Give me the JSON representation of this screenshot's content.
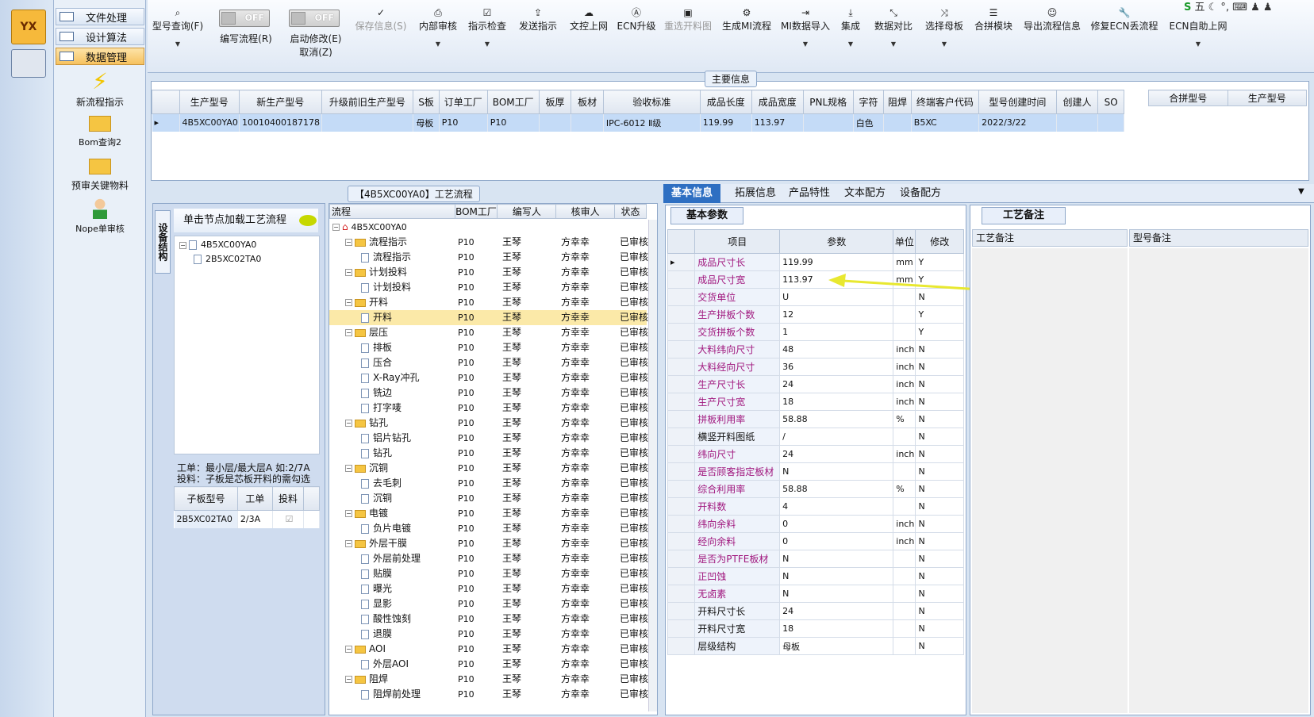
{
  "nav": {
    "items": [
      "文件处理",
      "设计算法",
      "数据管理"
    ],
    "active": 2,
    "tools": [
      {
        "label": "新流程指示",
        "icon": "lightning-icon"
      },
      {
        "label": "Bom查询2",
        "icon": "folder-icon"
      },
      {
        "label": "预审关键物料",
        "icon": "folder-icon"
      },
      {
        "label": "Nope单审核",
        "icon": "user-icon"
      }
    ]
  },
  "toolbar": {
    "query": "型号查询(F)",
    "toggle1": {
      "state": "OFF",
      "label": "编写流程(R)"
    },
    "toggle2": {
      "state": "OFF",
      "label": "启动修改(E)",
      "sub": "取消(Z)"
    },
    "buttons": [
      "保存信息(S)",
      "内部审核",
      "指示检查",
      "发送指示",
      "文控上网",
      "ECN升级",
      "重选开料图",
      "生成MI流程",
      "MI数据导入",
      "集成",
      "数据对比",
      "选择母板",
      "合拼模块",
      "导出流程信息",
      "修复ECN丢流程",
      "ECN自助上网"
    ]
  },
  "main_info": {
    "caption": "主要信息",
    "columns": [
      "生产型号",
      "新生产型号",
      "升级前旧生产型号",
      "S板",
      "订单工厂",
      "BOM工厂",
      "板厚",
      "板材",
      "验收标准",
      "成品长度",
      "成品宽度",
      "PNL规格",
      "字符",
      "阻焊",
      "终端客户代码",
      "型号创建时间",
      "创建人",
      "SO"
    ],
    "row": [
      "4B5XC00YA0",
      "10010400187178",
      "",
      "母板",
      "P10",
      "P10",
      "",
      "",
      "IPC-6012 Ⅱ级",
      "119.99",
      "113.97",
      "",
      "白色",
      "",
      "B5XC",
      "2022/3/22",
      "",
      ""
    ],
    "merge_columns": [
      "合拼型号",
      "生产型号"
    ]
  },
  "left_panel": {
    "vertical_tab": "设备结构",
    "hint": "单击节点加载工艺流程",
    "tree": [
      "4B5XC00YA0",
      "2B5XC02TA0"
    ],
    "note1": "工单：最小层/最大层A 如:2/7A",
    "note2": "投料：子板是芯板开料的需勾选",
    "sub_columns": [
      "子板型号",
      "工单",
      "投料"
    ],
    "sub_row": [
      "2B5XC02TA0",
      "2/3A",
      ""
    ]
  },
  "process": {
    "caption": "【4B5XC00YA0】工艺流程",
    "columns": [
      "流程",
      "BOM工厂",
      "编写人",
      "核审人",
      "状态"
    ],
    "root": "4B5XC00YA0",
    "rows": [
      {
        "name": "流程指示",
        "level": 1,
        "folder": true
      },
      {
        "name": "流程指示",
        "level": 2
      },
      {
        "name": "计划投料",
        "level": 1,
        "folder": true
      },
      {
        "name": "计划投料",
        "level": 2
      },
      {
        "name": "开料",
        "level": 1,
        "folder": true
      },
      {
        "name": "开料",
        "level": 2,
        "selected": true
      },
      {
        "name": "层压",
        "level": 1,
        "folder": true
      },
      {
        "name": "排板",
        "level": 2
      },
      {
        "name": "压合",
        "level": 2
      },
      {
        "name": "X-Ray冲孔",
        "level": 2
      },
      {
        "name": "铣边",
        "level": 2
      },
      {
        "name": "打字唛",
        "level": 2
      },
      {
        "name": "钻孔",
        "level": 1,
        "folder": true
      },
      {
        "name": "铝片钻孔",
        "level": 2
      },
      {
        "name": "钻孔",
        "level": 2
      },
      {
        "name": "沉铜",
        "level": 1,
        "folder": true
      },
      {
        "name": "去毛刺",
        "level": 2
      },
      {
        "name": "沉铜",
        "level": 2
      },
      {
        "name": "电镀",
        "level": 1,
        "folder": true
      },
      {
        "name": "负片电镀",
        "level": 2
      },
      {
        "name": "外层干膜",
        "level": 1,
        "folder": true
      },
      {
        "name": "外层前处理",
        "level": 2
      },
      {
        "name": "贴膜",
        "level": 2
      },
      {
        "name": "曝光",
        "level": 2
      },
      {
        "name": "显影",
        "level": 2
      },
      {
        "name": "酸性蚀刻",
        "level": 2
      },
      {
        "name": "退膜",
        "level": 2
      },
      {
        "name": "AOI",
        "level": 1,
        "folder": true
      },
      {
        "name": "外层AOI",
        "level": 2
      },
      {
        "name": "阻焊",
        "level": 1,
        "folder": true
      },
      {
        "name": "阻焊前处理",
        "level": 2
      }
    ],
    "bom": "P10",
    "writer": "王琴",
    "reviewer": "方幸幸",
    "status": "已审核"
  },
  "tabs": [
    "基本信息",
    "拓展信息",
    "产品特性",
    "文本配方",
    "设备配方"
  ],
  "basic": {
    "tab": "基本参数",
    "columns": [
      "项目",
      "参数",
      "单位",
      "修改"
    ],
    "rows": [
      {
        "k": "成品尺寸长",
        "v": "119.99",
        "u": "mm",
        "m": "Y",
        "c": 1
      },
      {
        "k": "成品尺寸宽",
        "v": "113.97",
        "u": "mm",
        "m": "Y",
        "c": 1
      },
      {
        "k": "交货单位",
        "v": "U",
        "u": "",
        "m": "N",
        "c": 1
      },
      {
        "k": "生产拼板个数",
        "v": "12",
        "u": "",
        "m": "Y",
        "c": 1
      },
      {
        "k": "交货拼板个数",
        "v": "1",
        "u": "",
        "m": "Y",
        "c": 1
      },
      {
        "k": "大料纬向尺寸",
        "v": "48",
        "u": "inch",
        "m": "N",
        "c": 1
      },
      {
        "k": "大料经向尺寸",
        "v": "36",
        "u": "inch",
        "m": "N",
        "c": 1
      },
      {
        "k": "生产尺寸长",
        "v": "24",
        "u": "inch",
        "m": "N",
        "c": 1
      },
      {
        "k": "生产尺寸宽",
        "v": "18",
        "u": "inch",
        "m": "N",
        "c": 1
      },
      {
        "k": "拼板利用率",
        "v": "58.88",
        "u": "%",
        "m": "N",
        "c": 1
      },
      {
        "k": "横竖开料图纸",
        "v": "/",
        "u": "",
        "m": "N",
        "c": 0
      },
      {
        "k": "纬向尺寸",
        "v": "24",
        "u": "inch",
        "m": "N",
        "c": 1
      },
      {
        "k": "是否顾客指定板材",
        "v": "N",
        "u": "",
        "m": "N",
        "c": 1
      },
      {
        "k": "综合利用率",
        "v": "58.88",
        "u": "%",
        "m": "N",
        "c": 1
      },
      {
        "k": "开料数",
        "v": "4",
        "u": "",
        "m": "N",
        "c": 1
      },
      {
        "k": "纬向余料",
        "v": "0",
        "u": "inch",
        "m": "N",
        "c": 1
      },
      {
        "k": "经向余料",
        "v": "0",
        "u": "inch",
        "m": "N",
        "c": 1
      },
      {
        "k": "是否为PTFE板材",
        "v": "N",
        "u": "",
        "m": "N",
        "c": 1
      },
      {
        "k": "正凹蚀",
        "v": "N",
        "u": "",
        "m": "N",
        "c": 1
      },
      {
        "k": "无卤素",
        "v": "N",
        "u": "",
        "m": "N",
        "c": 1
      },
      {
        "k": "开料尺寸长",
        "v": "24",
        "u": "",
        "m": "N",
        "c": 0
      },
      {
        "k": "开料尺寸宽",
        "v": "18",
        "u": "",
        "m": "N",
        "c": 0
      },
      {
        "k": "层级结构",
        "v": "母板",
        "u": "",
        "m": "N",
        "c": 0
      }
    ]
  },
  "remarks": {
    "tab": "工艺备注",
    "left": "工艺备注",
    "right": "型号备注"
  }
}
